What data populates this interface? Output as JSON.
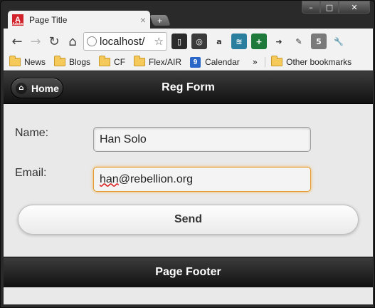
{
  "browser": {
    "tab_title": "Page Title",
    "tab_close": "×",
    "new_tab": "+",
    "favicon_text": "A",
    "favicon_small": "Adobe",
    "url": "localhost/",
    "window_controls": {
      "minimize": "–",
      "maximize": "□",
      "close": "✕"
    }
  },
  "toolbar_icons": [
    "back-icon",
    "forward-icon",
    "reload-icon",
    "home-icon",
    "bookmark-star-icon"
  ],
  "extensions": [
    {
      "name": "extension-phone-icon",
      "color": "#2b2b2b",
      "glyph": "▯"
    },
    {
      "name": "extension-colorwheel-icon",
      "color": "#3a3a3a",
      "glyph": "◎"
    },
    {
      "name": "extension-amazon-icon",
      "color": "#f2f2f2",
      "glyph": "a"
    },
    {
      "name": "extension-wave-icon",
      "color": "#2a7f9e",
      "glyph": "≋"
    },
    {
      "name": "extension-plus-icon",
      "color": "#1e7a3a",
      "glyph": "+"
    },
    {
      "name": "extension-device-icon",
      "color": "#f2f2f2",
      "glyph": "➜"
    },
    {
      "name": "extension-eyedropper-icon",
      "color": "#f2f2f2",
      "glyph": "✎"
    },
    {
      "name": "extension-stack-icon",
      "color": "#7a7a7a",
      "glyph": "5"
    },
    {
      "name": "wrench-icon",
      "color": "#f2f2f2",
      "glyph": "🔧"
    }
  ],
  "bookmarks": {
    "items": [
      "News",
      "Blogs",
      "CF",
      "Flex/AIR"
    ],
    "calendar_label": "Calendar",
    "calendar_badge": "9",
    "overflow": "»",
    "other": "Other bookmarks"
  },
  "app": {
    "home_label": "Home",
    "title": "Reg Form",
    "footer": "Page Footer"
  },
  "form": {
    "name_label": "Name:",
    "name_value": "Han Solo",
    "email_label": "Email:",
    "email_user": "han",
    "email_domain": "@rebellion.org",
    "send_label": "Send"
  },
  "colors": {
    "header_bg": "#1c1c1c",
    "page_bg": "#e9e9e9",
    "focus_border": "#e49a2d",
    "favicon_red": "#d2232a",
    "calendar_blue": "#2a66c8"
  }
}
